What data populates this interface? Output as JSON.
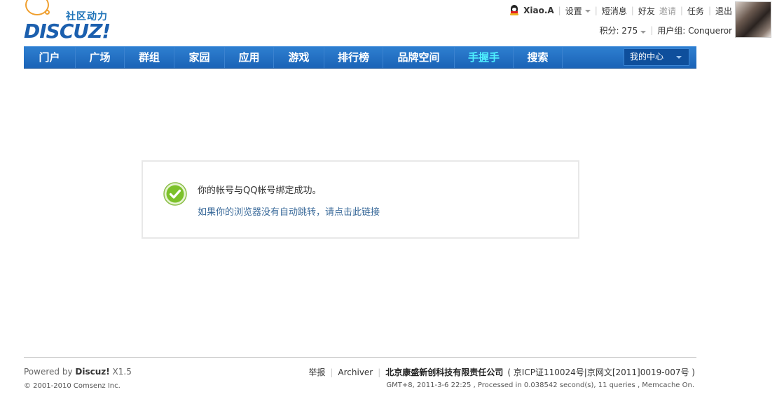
{
  "logo": {
    "tagline": "社区动力",
    "brand": "DISCUZ!"
  },
  "userbar": {
    "username": "Xiao.A",
    "settings": "设置",
    "messages": "短消息",
    "friends": "好友",
    "invite": "邀请",
    "tasks": "任务",
    "logout": "退出"
  },
  "userinfo": {
    "credits_label": "积分: 275",
    "group_label": "用户组: Conqueror"
  },
  "nav": {
    "items": [
      {
        "label": "门户"
      },
      {
        "label": "广场"
      },
      {
        "label": "群组"
      },
      {
        "label": "家园"
      },
      {
        "label": "应用"
      },
      {
        "label": "游戏"
      },
      {
        "label": "排行榜"
      },
      {
        "label": "品牌空间"
      },
      {
        "label": "手握手"
      },
      {
        "label": "搜索"
      }
    ],
    "my_center": "我的中心"
  },
  "message": {
    "text": "你的帐号与QQ帐号绑定成功。",
    "redirect_link": "如果你的浏览器没有自动跳转，请点击此链接"
  },
  "footer": {
    "powered_prefix": "Powered by ",
    "powered_brand": "Discuz!",
    "powered_version": " X1.5",
    "copyright": "© 2001-2010 Comsenz Inc.",
    "report": "举报",
    "archiver": "Archiver",
    "company": "北京康盛新创科技有限责任公司",
    "icp": "( 京ICP证110024号|京网文[2011]0019-007号 )",
    "debug": "GMT+8, 2011-3-6 22:25 , Processed in 0.038542 second(s), 11 queries , Memcache On."
  },
  "colors": {
    "nav_bg": "#1a63b7",
    "nav_active": "#4ff0ff",
    "link": "#3a6a9a",
    "success_icon": "#7cc12a"
  }
}
